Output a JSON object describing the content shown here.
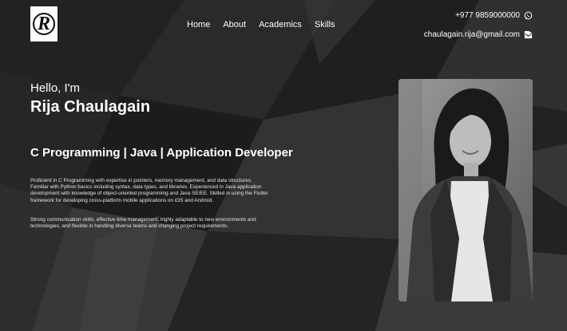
{
  "logo": {
    "letter": "R"
  },
  "nav": {
    "items": [
      {
        "label": "Home"
      },
      {
        "label": "About"
      },
      {
        "label": "Academics"
      },
      {
        "label": "Skills"
      }
    ]
  },
  "contact": {
    "phone": "+977 9859000000",
    "phone_icon": "whatsapp-icon",
    "email": "chaulagain.rija@gmail.com",
    "email_icon": "mail-icon"
  },
  "hero": {
    "greeting": "Hello, I'm",
    "name": "Rija Chaulagain",
    "headline": "C Programming | Java | Application Developer",
    "paragraphs": [
      "Proficient in C Programming with expertise in pointers, memory management, and data structures. Familiar with Python basics including syntax, data types, and libraries. Experienced in Java application development with knowledge of object-oriented programming and Java SE/EE. Skilled in using the Flutter framework for developing cross-platform mobile applications on iOS and Android.",
      "Strong communication skills, effective time management, highly adaptable to new environments and technologies, and flexible in handling diverse teams and changing project requirements."
    ]
  },
  "colors": {
    "background": "#1b1b1b",
    "text": "#ffffff"
  }
}
